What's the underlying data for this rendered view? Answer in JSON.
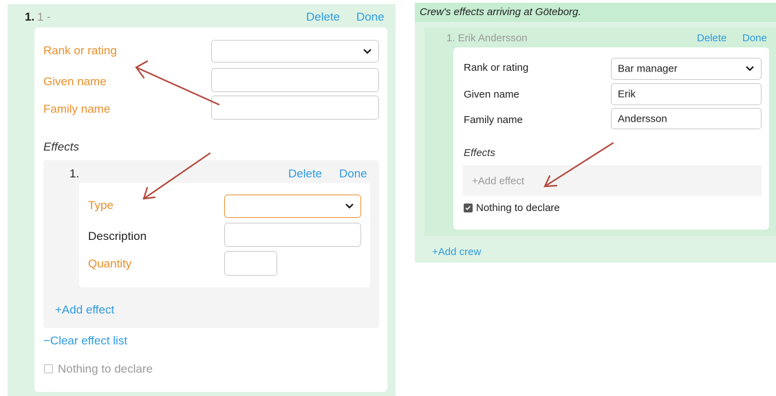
{
  "left": {
    "crew_index": "1.",
    "crew_subtitle": "1 -",
    "delete_label": "Delete",
    "done_label": "Done",
    "fields": {
      "rank": "Rank or rating",
      "given": "Given name",
      "family": "Family name"
    },
    "effects_heading": "Effects",
    "effect": {
      "index": "1.",
      "delete_label": "Delete",
      "done_label": "Done",
      "type_label": "Type",
      "description_label": "Description",
      "quantity_label": "Quantity"
    },
    "add_effect": "+Add effect",
    "clear_effect_list": "−Clear effect list",
    "nothing_to_declare": "Nothing to declare",
    "nothing_checked": false
  },
  "right": {
    "header": "Crew's effects arriving at Göteborg.",
    "crew_title": "1. Erik Andersson",
    "delete_label": "Delete",
    "done_label": "Done",
    "fields": {
      "rank": "Rank or rating",
      "rank_value": "Bar manager",
      "given": "Given name",
      "given_value": "Erik",
      "family": "Family name",
      "family_value": "Andersson"
    },
    "effects_heading": "Effects",
    "add_effect": "+Add effect",
    "nothing_to_declare": "Nothing to declare",
    "nothing_checked": true,
    "add_crew": "+Add crew"
  },
  "colors": {
    "accent_link": "#2f9be0",
    "required_label": "#e8902c",
    "arrow": "#b34a3f",
    "panel_green": "#dff3e4"
  }
}
